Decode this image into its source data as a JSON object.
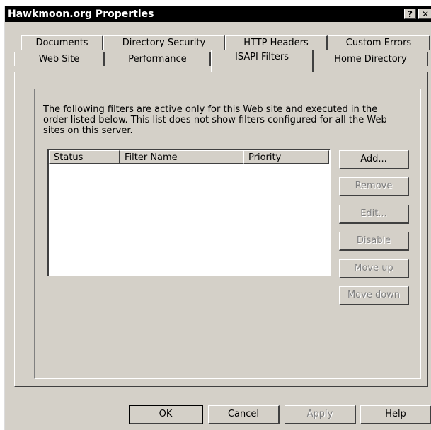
{
  "window": {
    "title": "Hawkmoon.org Properties",
    "help_glyph": "?",
    "close_glyph": "✕"
  },
  "tabs": {
    "row1": [
      "Documents",
      "Directory Security",
      "HTTP Headers",
      "Custom Errors"
    ],
    "row2": [
      "Web Site",
      "Performance",
      "ISAPI Filters",
      "Home Directory"
    ],
    "active": "ISAPI Filters"
  },
  "panel": {
    "description": "The following filters are active only for this Web site and executed in the order listed below. This list does not show filters configured for all the Web sites on this server.",
    "columns": [
      "Status",
      "Filter Name",
      "Priority"
    ],
    "rows": []
  },
  "side_buttons": {
    "add": "Add...",
    "remove": "Remove",
    "edit": "Edit...",
    "disable": "Disable",
    "move_up": "Move up",
    "move_down": "Move down"
  },
  "footer_buttons": {
    "ok": "OK",
    "cancel": "Cancel",
    "apply": "Apply",
    "help": "Help"
  }
}
